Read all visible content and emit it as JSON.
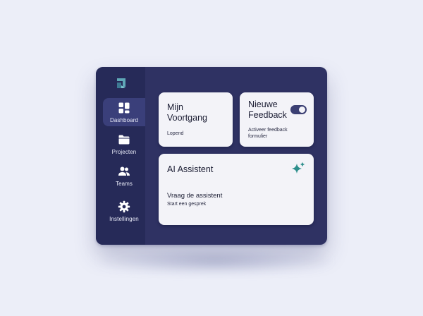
{
  "sidebar": {
    "logo_icon": "app-logo-icon",
    "items": [
      {
        "label": "Dashboard",
        "icon": "dashboard-grid-icon",
        "active": true
      },
      {
        "label": "Projecten",
        "icon": "folder-icon",
        "active": false
      },
      {
        "label": "Teams",
        "icon": "people-icon",
        "active": false
      },
      {
        "label": "Instellingen",
        "icon": "gear-icon",
        "active": false
      }
    ]
  },
  "cards": {
    "progress": {
      "title": "Mijn\nVoortgang",
      "subtitle": "Lopend"
    },
    "feedback": {
      "title": "Nieuwe\nFeedback",
      "subtitle": "Activeer feedback\nformulier",
      "toggle_on": true
    },
    "ai": {
      "title": "AI Assistent",
      "prompt": "Vraag de assistent",
      "subtitle": "Start een gesprek",
      "icon": "sparkle-icon"
    }
  },
  "colors": {
    "background": "#eceef8",
    "device": "#2f3263",
    "sidebar": "#262a58",
    "sidebar_active": "#3a3f7a",
    "card": "#f3f3f8",
    "accent_teal": "#2e8f8c"
  }
}
